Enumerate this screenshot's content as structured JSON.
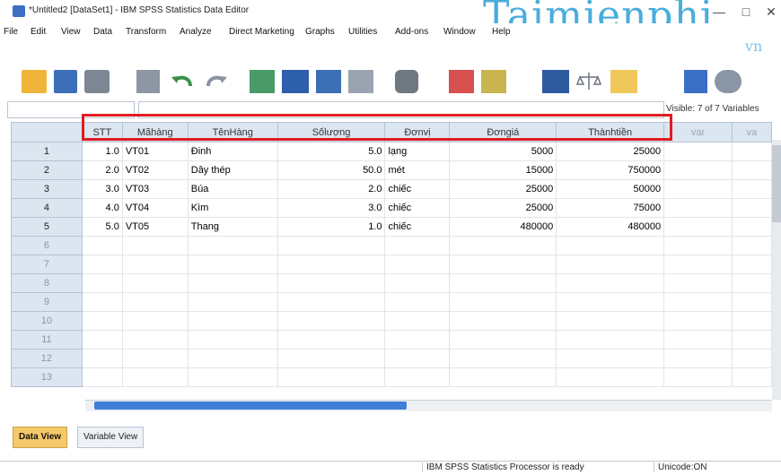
{
  "window": {
    "title": "*Untitled2 [DataSet1] - IBM SPSS Statistics Data Editor",
    "watermark": "Taimienphi",
    "watermark_sub": "vn",
    "close_glyph": "✕"
  },
  "menu": [
    "File",
    "Edit",
    "View",
    "Data",
    "Transform",
    "Analyze",
    "Direct Marketing",
    "Graphs",
    "Utilities",
    "Add-ons",
    "Window",
    "Help"
  ],
  "toolbar_icons": [
    "open-folder-icon",
    "save-icon",
    "print-icon",
    "dialog-recall-icon",
    "undo-icon",
    "redo-icon",
    "go-to-case-icon",
    "go-to-variable-icon",
    "variables-icon",
    "run-descriptive-icon",
    "find-icon",
    "insert-cases-icon",
    "insert-variable-icon",
    "split-file-icon",
    "weight-cases-icon",
    "select-cases-icon",
    "value-labels-icon",
    "use-sets-icon"
  ],
  "cellbar": {
    "visible": "Visible: 7 of 7 Variables"
  },
  "grid": {
    "columns": [
      "STT",
      "Mãhàng",
      "TênHàng",
      "Sốlượng",
      "Đơnvị",
      "Đơngiá",
      "Thànhtiền",
      "var",
      "va"
    ],
    "rows": [
      {
        "n": "1",
        "cells": [
          "1.0",
          "VT01",
          "Đinh",
          "5.0",
          "lạng",
          "5000",
          "25000"
        ]
      },
      {
        "n": "2",
        "cells": [
          "2.0",
          "VT02",
          "Dây thép",
          "50.0",
          "mét",
          "15000",
          "750000"
        ]
      },
      {
        "n": "3",
        "cells": [
          "3.0",
          "VT03",
          "Búa",
          "2.0",
          "chiếc",
          "25000",
          "50000"
        ]
      },
      {
        "n": "4",
        "cells": [
          "4.0",
          "VT04",
          "Kìm",
          "3.0",
          "chiếc",
          "25000",
          "75000"
        ]
      },
      {
        "n": "5",
        "cells": [
          "5.0",
          "VT05",
          "Thang",
          "1.0",
          "chiếc",
          "480000",
          "480000"
        ]
      }
    ],
    "empty_rows": [
      "6",
      "7",
      "8",
      "9",
      "10",
      "11",
      "12",
      "13"
    ]
  },
  "tabs": {
    "data_view": "Data View",
    "variable_view": "Variable View"
  },
  "status": {
    "processor": "IBM SPSS Statistics Processor is ready",
    "unicode": "Unicode:ON"
  },
  "colors": {
    "highlight": "#e11b22",
    "header": "#dce6f1",
    "active_tab": "#f5c969"
  }
}
